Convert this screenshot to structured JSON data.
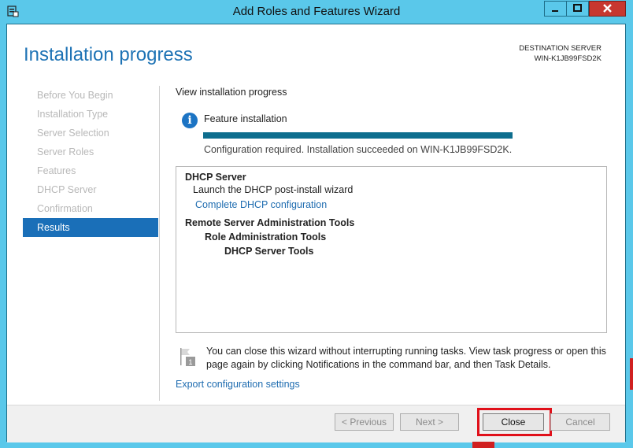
{
  "window": {
    "title": "Add Roles and Features Wizard"
  },
  "page_title": "Installation progress",
  "destination": {
    "label": "DESTINATION SERVER",
    "server": "WIN-K1JB99FSD2K"
  },
  "nav": {
    "items": [
      {
        "label": "Before You Begin",
        "active": false
      },
      {
        "label": "Installation Type",
        "active": false
      },
      {
        "label": "Server Selection",
        "active": false
      },
      {
        "label": "Server Roles",
        "active": false
      },
      {
        "label": "Features",
        "active": false
      },
      {
        "label": "DHCP Server",
        "active": false
      },
      {
        "label": "Confirmation",
        "active": false
      },
      {
        "label": "Results",
        "active": true
      }
    ]
  },
  "main": {
    "heading": "View installation progress",
    "feature_label": "Feature installation",
    "progress_value": 1.0,
    "status": "Configuration required. Installation succeeded on WIN-K1JB99FSD2K.",
    "results": {
      "dhcp_title": "DHCP Server",
      "dhcp_launch": "Launch the DHCP post-install wizard",
      "dhcp_link": "Complete DHCP configuration",
      "rsat_title": "Remote Server Administration Tools",
      "rsat_role_tools": "Role Administration Tools",
      "rsat_dhcp_tools": "DHCP Server Tools"
    },
    "notice": "You can close this wizard without interrupting running tasks. View task progress or open this page again by clicking Notifications in the command bar, and then Task Details.",
    "notice_badge": "1",
    "export_link": "Export configuration settings"
  },
  "footer": {
    "prev": "< Previous",
    "next": "Next >",
    "close": "Close",
    "cancel": "Cancel"
  },
  "colors": {
    "titlebar": "#5ac8ea",
    "accent": "#1e73b5",
    "nav_active": "#1a6fb8",
    "progress": "#0e6e8e",
    "highlight": "#e0101a"
  }
}
